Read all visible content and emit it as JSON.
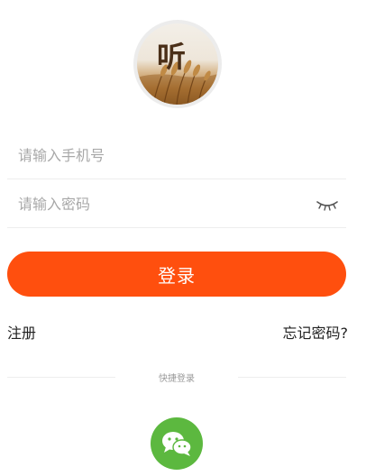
{
  "logo": {
    "character": "听",
    "icon": "app-logo-wheat-icon"
  },
  "login_form": {
    "phone_placeholder": "请输入手机号",
    "password_placeholder": "请输入密码",
    "password_toggle_icon": "eye-closed-icon",
    "login_button_label": "登录"
  },
  "links": {
    "register": "注册",
    "forgot_password": "忘记密码?"
  },
  "quick_login": {
    "label": "快捷登录",
    "wechat_icon": "wechat-icon"
  },
  "colors": {
    "accent": "#ff4f0e",
    "wechat": "#5cb83f"
  }
}
